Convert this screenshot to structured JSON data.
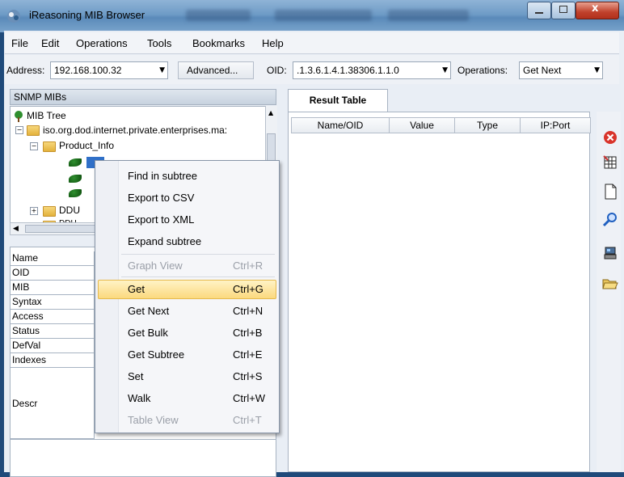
{
  "window": {
    "title": "iReasoning MIB Browser"
  },
  "menu": [
    "File",
    "Edit",
    "Operations",
    "Tools",
    "Bookmarks",
    "Help"
  ],
  "toolbar": {
    "address_label": "Address:",
    "address_value": "192.168.100.32",
    "advanced_label": "Advanced...",
    "oid_label": "OID:",
    "oid_value": ".1.3.6.1.4.1.38306.1.1.0",
    "operations_label": "Operations:",
    "operations_value": "Get Next"
  },
  "left_panel": {
    "header": "SNMP MIBs",
    "tree": {
      "root": "MIB Tree",
      "node1": "iso.org.dod.internet.private.enterprises.ma:",
      "node2": "Product_Info",
      "node3": "DDU",
      "node4": "DDU"
    },
    "props": [
      "Name",
      "OID",
      "MIB",
      "Syntax",
      "Access",
      "Status",
      "DefVal",
      "Indexes",
      "Descr"
    ]
  },
  "right_panel": {
    "tab": "Result Table",
    "columns": [
      "Name/OID",
      "Value",
      "Type",
      "IP:Port"
    ]
  },
  "context_menu": [
    {
      "label": "Find in subtree",
      "shortcut": ""
    },
    {
      "label": "Export to CSV",
      "shortcut": ""
    },
    {
      "label": "Export to XML",
      "shortcut": ""
    },
    {
      "label": "Expand subtree",
      "shortcut": ""
    },
    {
      "label": "Graph View",
      "shortcut": "Ctrl+R"
    },
    {
      "label": "Get",
      "shortcut": "Ctrl+G"
    },
    {
      "label": "Get Next",
      "shortcut": "Ctrl+N"
    },
    {
      "label": "Get Bulk",
      "shortcut": "Ctrl+B"
    },
    {
      "label": "Get Subtree",
      "shortcut": "Ctrl+E"
    },
    {
      "label": "Set",
      "shortcut": "Ctrl+S"
    },
    {
      "label": "Walk",
      "shortcut": "Ctrl+W"
    },
    {
      "label": "Table View",
      "shortcut": "Ctrl+T"
    }
  ],
  "side_icons": [
    "stop-icon",
    "table-export-icon",
    "document-icon",
    "search-icon",
    "network-icon",
    "open-folder-icon"
  ],
  "colors": {
    "highlight": "#fbd97e",
    "titlebar": "#6e9bc6",
    "stop": "#d9342b"
  }
}
